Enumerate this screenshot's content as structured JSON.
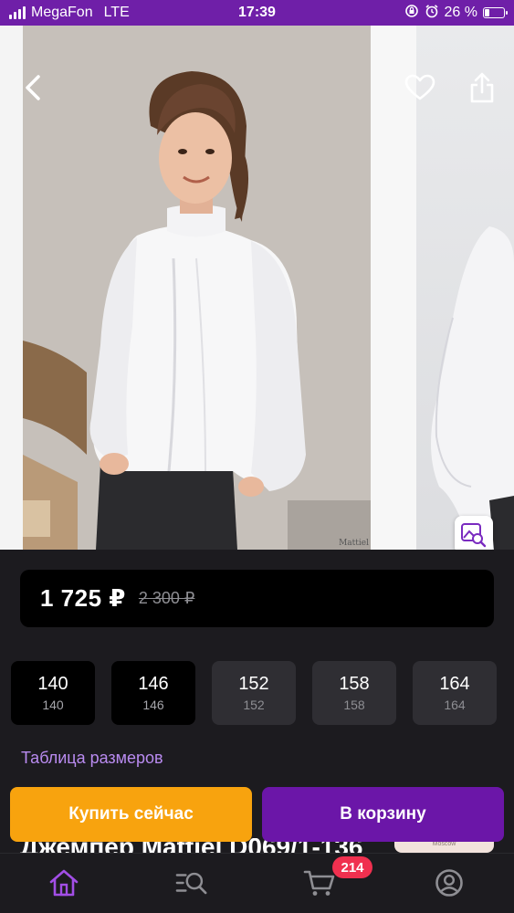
{
  "status_bar": {
    "carrier": "MegaFon",
    "network": "LTE",
    "time": "17:39",
    "battery": "26 %",
    "battery_level": 0.26
  },
  "gallery": {
    "watermark": "Mattiel",
    "icons": [
      "back-icon",
      "heart-icon",
      "share-icon",
      "image-search-icon"
    ]
  },
  "price": {
    "current": "1 725 ₽",
    "old": "2 300 ₽"
  },
  "sizes": [
    {
      "label": "140",
      "sub": "140"
    },
    {
      "label": "146",
      "sub": "146"
    },
    {
      "label": "152",
      "sub": "152"
    },
    {
      "label": "158",
      "sub": "158"
    },
    {
      "label": "164",
      "sub": "164"
    }
  ],
  "size_table_link": "Таблица размеров",
  "product_title": "Джемпер Mattiel D069/1-136",
  "brand_thumb_text": "Moscow",
  "actions": {
    "buy_now": "Купить сейчас",
    "add_to_cart": "В корзину"
  },
  "nav": {
    "items": [
      "home-icon",
      "catalog-search-icon",
      "cart-icon",
      "profile-icon"
    ],
    "cart_count": "214"
  },
  "colors": {
    "accent_purple": "#6b16a8",
    "buy_orange": "#f8a30e",
    "link_lilac": "#b98bf0",
    "badge_red": "#f0304f",
    "background": "#1c1b1f"
  }
}
